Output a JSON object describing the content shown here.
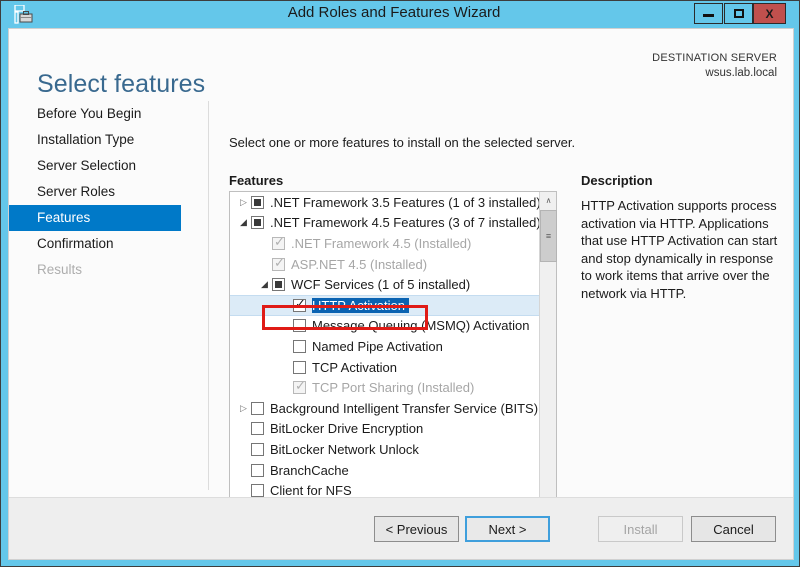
{
  "window": {
    "title": "Add Roles and Features Wizard",
    "icon": "server-wizard-icon",
    "minimize_label": "minimize",
    "maximize_label": "maximize",
    "close_label": "X",
    "accent_color": "#64c7ea",
    "close_color": "#c0504d"
  },
  "header": {
    "page_title": "Select features",
    "destination_label": "DESTINATION SERVER",
    "destination_value": "wsus.lab.local"
  },
  "nav": {
    "items": [
      {
        "label": "Before You Begin",
        "state": "normal"
      },
      {
        "label": "Installation Type",
        "state": "normal"
      },
      {
        "label": "Server Selection",
        "state": "normal"
      },
      {
        "label": "Server Roles",
        "state": "normal"
      },
      {
        "label": "Features",
        "state": "active"
      },
      {
        "label": "Confirmation",
        "state": "normal"
      },
      {
        "label": "Results",
        "state": "disabled"
      }
    ],
    "active_color": "#0079c8"
  },
  "content": {
    "intro": "Select one or more features to install on the selected server.",
    "features_label": "Features",
    "description_label": "Description",
    "description_body": "HTTP Activation supports process activation via HTTP. Applications that use HTTP Activation can start and stop dynamically in response to work items that arrive over the network via HTTP."
  },
  "tree": {
    "rows": [
      {
        "indent": 0,
        "expander": "collapsed",
        "checkbox": "partial",
        "label": ".NET Framework 3.5 Features (1 of 3 installed)",
        "state": "normal"
      },
      {
        "indent": 0,
        "expander": "expanded",
        "checkbox": "partial",
        "label": ".NET Framework 4.5 Features (3 of 7 installed)",
        "state": "normal"
      },
      {
        "indent": 1,
        "expander": "none",
        "checkbox": "checked-disabled",
        "label": ".NET Framework 4.5 (Installed)",
        "state": "disabled"
      },
      {
        "indent": 1,
        "expander": "none",
        "checkbox": "checked-disabled",
        "label": "ASP.NET 4.5 (Installed)",
        "state": "disabled"
      },
      {
        "indent": 1,
        "expander": "expanded",
        "checkbox": "partial",
        "label": "WCF Services (1 of 5 installed)",
        "state": "normal"
      },
      {
        "indent": 2,
        "expander": "none",
        "checkbox": "checked",
        "label": "HTTP Activation",
        "state": "selected"
      },
      {
        "indent": 2,
        "expander": "none",
        "checkbox": "unchecked",
        "label": "Message Queuing (MSMQ) Activation",
        "state": "normal"
      },
      {
        "indent": 2,
        "expander": "none",
        "checkbox": "unchecked",
        "label": "Named Pipe Activation",
        "state": "normal"
      },
      {
        "indent": 2,
        "expander": "none",
        "checkbox": "unchecked",
        "label": "TCP Activation",
        "state": "normal"
      },
      {
        "indent": 2,
        "expander": "none",
        "checkbox": "checked-disabled",
        "label": "TCP Port Sharing (Installed)",
        "state": "disabled"
      },
      {
        "indent": 0,
        "expander": "collapsed",
        "checkbox": "unchecked",
        "label": "Background Intelligent Transfer Service (BITS)",
        "state": "normal"
      },
      {
        "indent": 0,
        "expander": "none",
        "checkbox": "unchecked",
        "label": "BitLocker Drive Encryption",
        "state": "normal"
      },
      {
        "indent": 0,
        "expander": "none",
        "checkbox": "unchecked",
        "label": "BitLocker Network Unlock",
        "state": "normal"
      },
      {
        "indent": 0,
        "expander": "none",
        "checkbox": "unchecked",
        "label": "BranchCache",
        "state": "normal"
      },
      {
        "indent": 0,
        "expander": "none",
        "checkbox": "unchecked",
        "label": "Client for NFS",
        "state": "normal"
      }
    ],
    "selection_color": "#0a63b2",
    "row_highlight_color": "#dcebf7",
    "scroll_up_glyph": "∧",
    "scroll_down_glyph": "∨",
    "scroll_left_glyph": "‹",
    "scroll_right_glyph": "›",
    "thumb_grip_glyph": "≡"
  },
  "annotation": {
    "target": "HTTP Activation",
    "color": "#e01b16"
  },
  "footer": {
    "previous_label": "< Previous",
    "next_label": "Next >",
    "install_label": "Install",
    "cancel_label": "Cancel",
    "install_enabled": false,
    "focus_color": "#3f9fdc"
  }
}
